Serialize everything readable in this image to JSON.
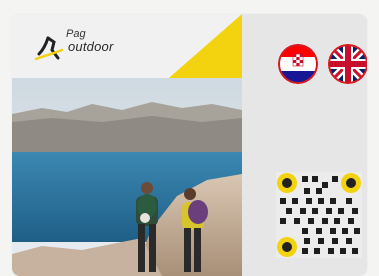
{
  "brand": {
    "name_top": "Pag",
    "name_bottom": "outdoor"
  },
  "colors": {
    "accent_yellow": "#f3d20f",
    "card_bg": "#e6e6e6",
    "sea_blue": "#2f7ea9"
  },
  "languages": [
    {
      "code": "hr",
      "flag": "croatia-flag-icon"
    },
    {
      "code": "en",
      "flag": "united-kingdom-flag-icon"
    }
  ],
  "qr": {
    "icon": "qr-code-icon"
  }
}
